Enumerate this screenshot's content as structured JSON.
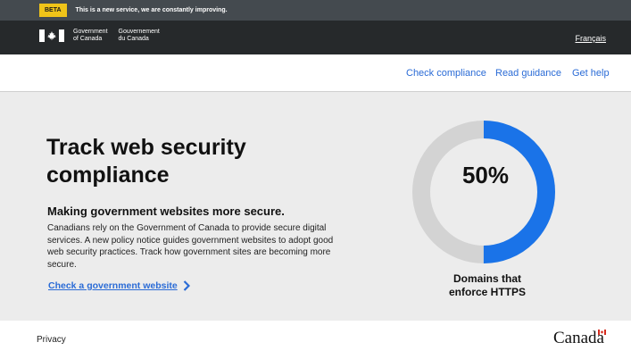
{
  "phase_banner": {
    "badge": "BETA",
    "message": "This is a new service, we are constantly improving."
  },
  "header": {
    "government_en": [
      "Government",
      "of Canada"
    ],
    "government_fr": [
      "Gouvernement",
      "du Canada"
    ],
    "language_toggle": "Français"
  },
  "nav": {
    "items": [
      "Check compliance",
      "Read guidance",
      "Get help"
    ]
  },
  "hero": {
    "title": "Track web security compliance",
    "subtitle": "Making government websites more secure.",
    "body": "Canadians rely on the Government of Canada to provide secure digital services. A new policy notice guides government websites to adopt good web security practices. Track how government sites are becoming more secure.",
    "cta_label": "Check a government website"
  },
  "stat": {
    "percent_label": "50%",
    "value_fraction": 0.5,
    "caption_line1": "Domains that",
    "caption_line2": "enforce HTTPS",
    "colors": {
      "fill": "#1a73e8",
      "track": "#d3d3d3"
    }
  },
  "footer": {
    "privacy": "Privacy",
    "wordmark": "Canada"
  },
  "colors": {
    "link": "#2a6bd6",
    "header_bg": "#26292b",
    "banner_bg": "#444a4f",
    "badge": "#f0c419",
    "hero_bg": "#ececec"
  }
}
